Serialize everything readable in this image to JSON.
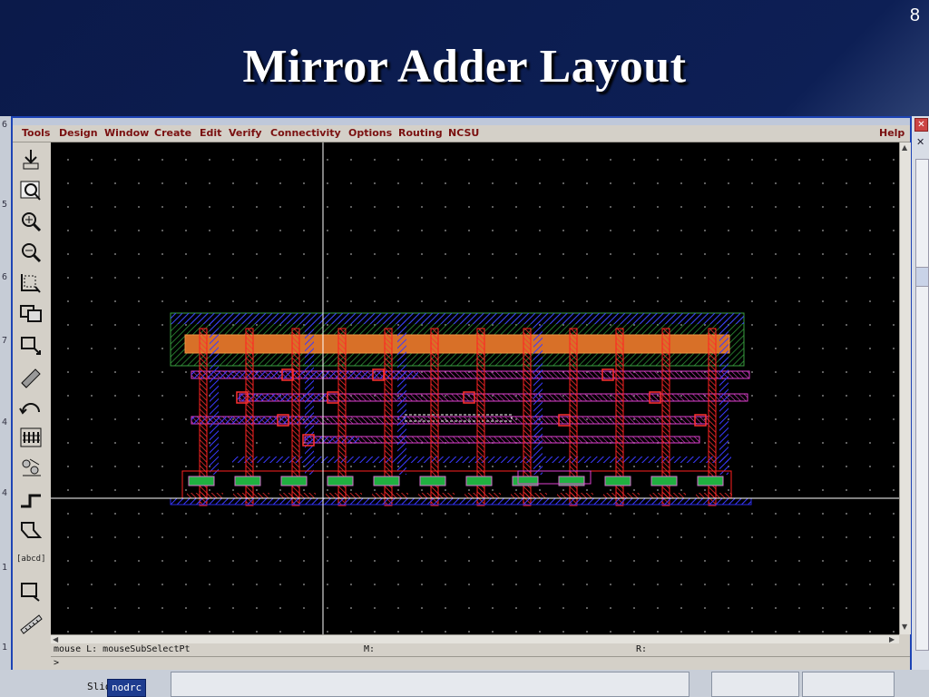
{
  "slide": {
    "number": "8",
    "title": "Mirror Adder Layout"
  },
  "menu": {
    "items": [
      "Tools",
      "Design",
      "Window",
      "Create",
      "Edit",
      "Verify",
      "Connectivity",
      "Options",
      "Routing",
      "NCSU"
    ],
    "help": "Help"
  },
  "toolbar": {
    "text_tool_label": "[abcd]"
  },
  "status": {
    "mouse_l": "mouse L: mouseSubSelectPt",
    "m": "M:",
    "r": "R:"
  },
  "command": {
    "prompt": ">"
  },
  "taskbar": {
    "item1": "Slid",
    "item2": "nodrc"
  },
  "colors": {
    "poly": "#e01818",
    "metal1": "#2a2ae0",
    "metal2": "#d020c8",
    "active": "#20b040",
    "nwell": "#3aa040",
    "contact": "#e07020"
  }
}
